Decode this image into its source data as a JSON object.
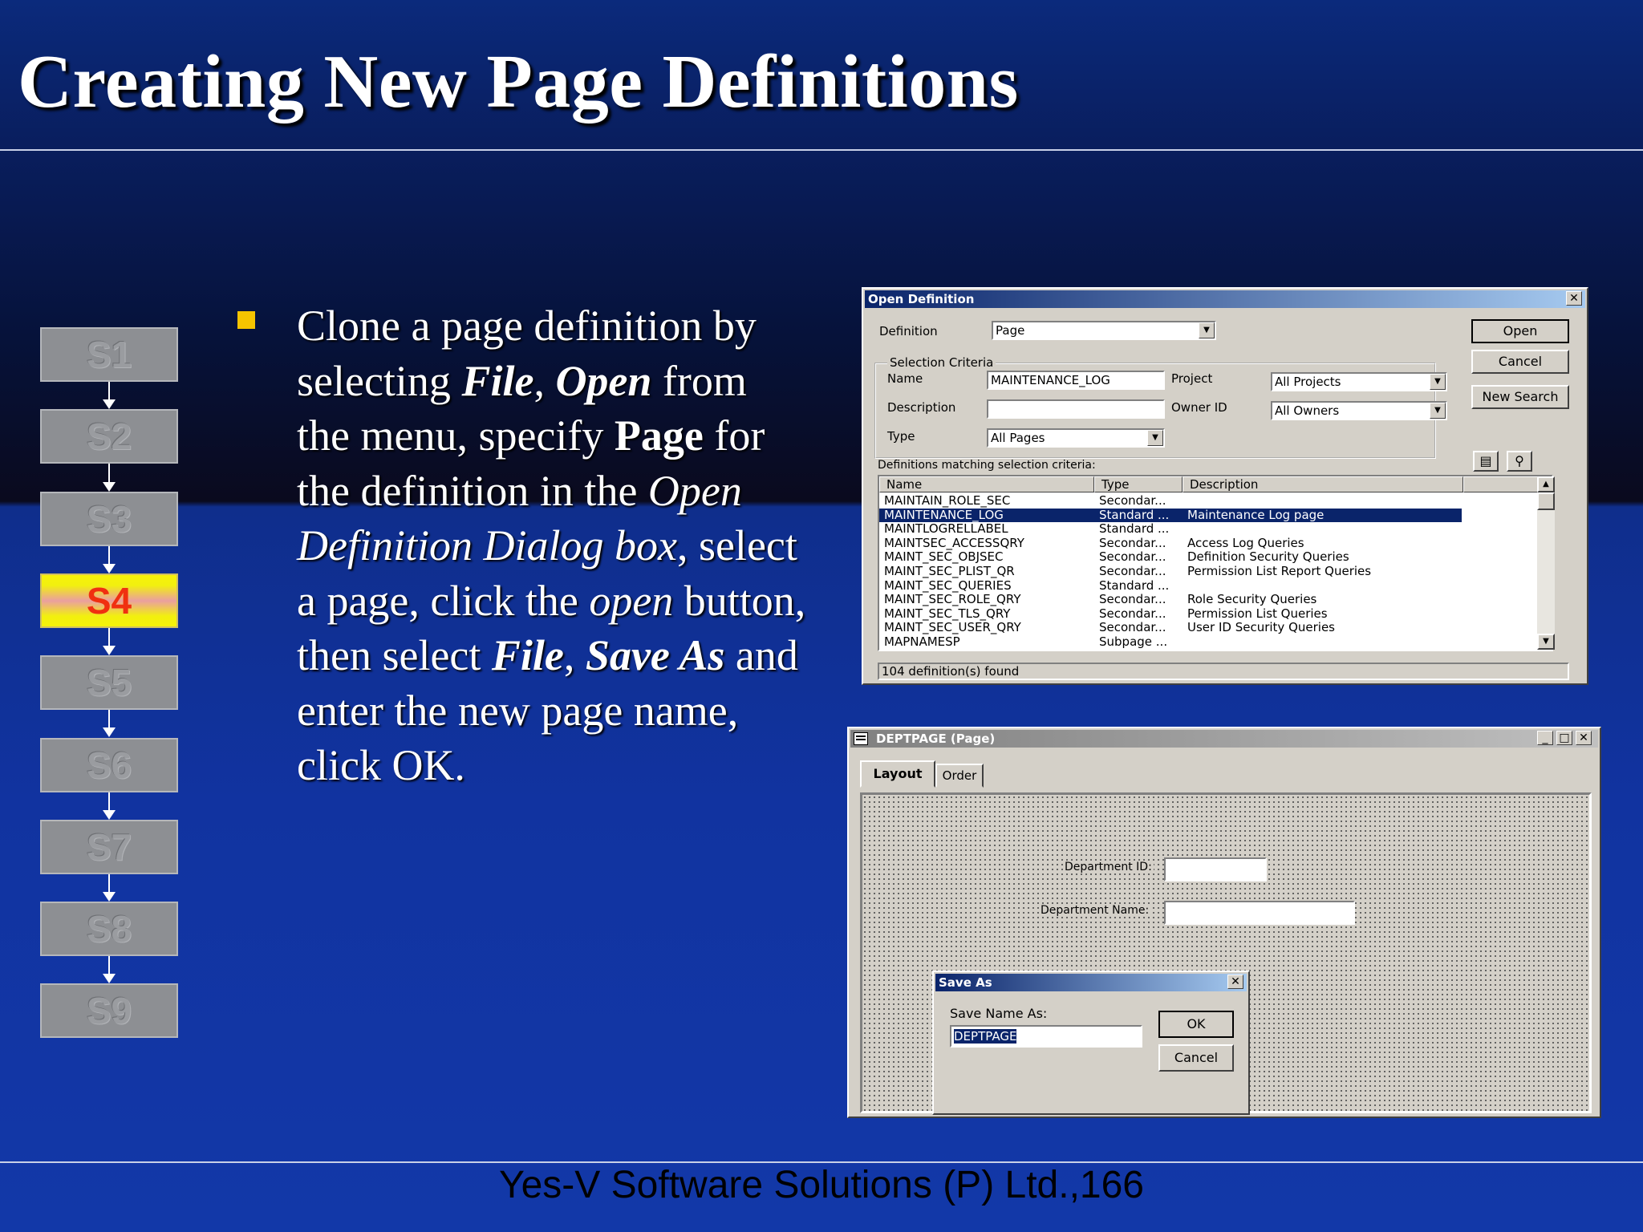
{
  "slide": {
    "title": "Creating New Page Definitions",
    "footer": "Yes-V Software Solutions (P) Ltd.,166"
  },
  "steps": [
    "S1",
    "S2",
    "S3",
    "S4",
    "S5",
    "S6",
    "S7",
    "S8",
    "S9"
  ],
  "active_step": "S4",
  "bullet": {
    "t1": "Clone a page definition by selecting ",
    "t2": "File",
    "t3": ", ",
    "t4": "Open",
    "t5": " from the menu, specify ",
    "t6": "Page",
    "t7": " for the definition in the ",
    "t8": "Open Definition Dialog box",
    "t9": ", select a page, click the ",
    "t10": "open",
    "t11": " button, then select ",
    "t12": "File",
    "t13": ", ",
    "t14": "Save As",
    "t15": " and enter the new page name, click OK."
  },
  "open_dialog": {
    "title": "Open Definition",
    "close_glyph": "✕",
    "definition_label": "Definition",
    "definition_value": "Page",
    "group_label": "Selection Criteria",
    "name_label": "Name",
    "name_value": "MAINTENANCE_LOG",
    "description_label": "Description",
    "description_value": "",
    "type_label": "Type",
    "type_value": "All Pages",
    "project_label": "Project",
    "project_value": "All Projects",
    "owner_label": "Owner ID",
    "owner_value": "All Owners",
    "open_button": "Open",
    "cancel_button": "Cancel",
    "new_search_button": "New Search",
    "matching_label": "Definitions matching selection criteria:",
    "columns": [
      "Name",
      "Type",
      "Description"
    ],
    "rows": [
      {
        "name": "MAINTAIN_ROLE_SEC",
        "type": "Secondar...",
        "desc": ""
      },
      {
        "name": "MAINTENANCE_LOG",
        "type": "Standard ...",
        "desc": "Maintenance Log page"
      },
      {
        "name": "MAINTLOGRELLABEL",
        "type": "Standard ...",
        "desc": ""
      },
      {
        "name": "MAINTSEC_ACCESSQRY",
        "type": "Secondar...",
        "desc": "Access Log Queries"
      },
      {
        "name": "MAINT_SEC_OBJSEC",
        "type": "Secondar...",
        "desc": "Definition Security Queries"
      },
      {
        "name": "MAINT_SEC_PLIST_QR",
        "type": "Secondar...",
        "desc": "Permission List Report Queries"
      },
      {
        "name": "MAINT_SEC_QUERIES",
        "type": "Standard ...",
        "desc": ""
      },
      {
        "name": "MAINT_SEC_ROLE_QRY",
        "type": "Secondar...",
        "desc": "Role Security Queries"
      },
      {
        "name": "MAINT_SEC_TLS_QRY",
        "type": "Secondar...",
        "desc": "Permission List Queries"
      },
      {
        "name": "MAINT_SEC_USER_QRY",
        "type": "Secondar...",
        "desc": "User ID Security Queries"
      },
      {
        "name": "MAPNAMESP",
        "type": "Subpage ...",
        "desc": ""
      }
    ],
    "selected_row": 1,
    "status": "104 definition(s) found"
  },
  "page_window": {
    "title": "DEPTPAGE (Page)",
    "tabs": [
      "Layout",
      "Order"
    ],
    "active_tab": "Layout",
    "dept_id_label": "Department ID:",
    "dept_name_label": "Department Name:"
  },
  "save_as": {
    "title": "Save As",
    "close_glyph": "✕",
    "prompt": "Save Name As:",
    "value": "DEPTPAGE",
    "ok_button": "OK",
    "cancel_button": "Cancel"
  }
}
